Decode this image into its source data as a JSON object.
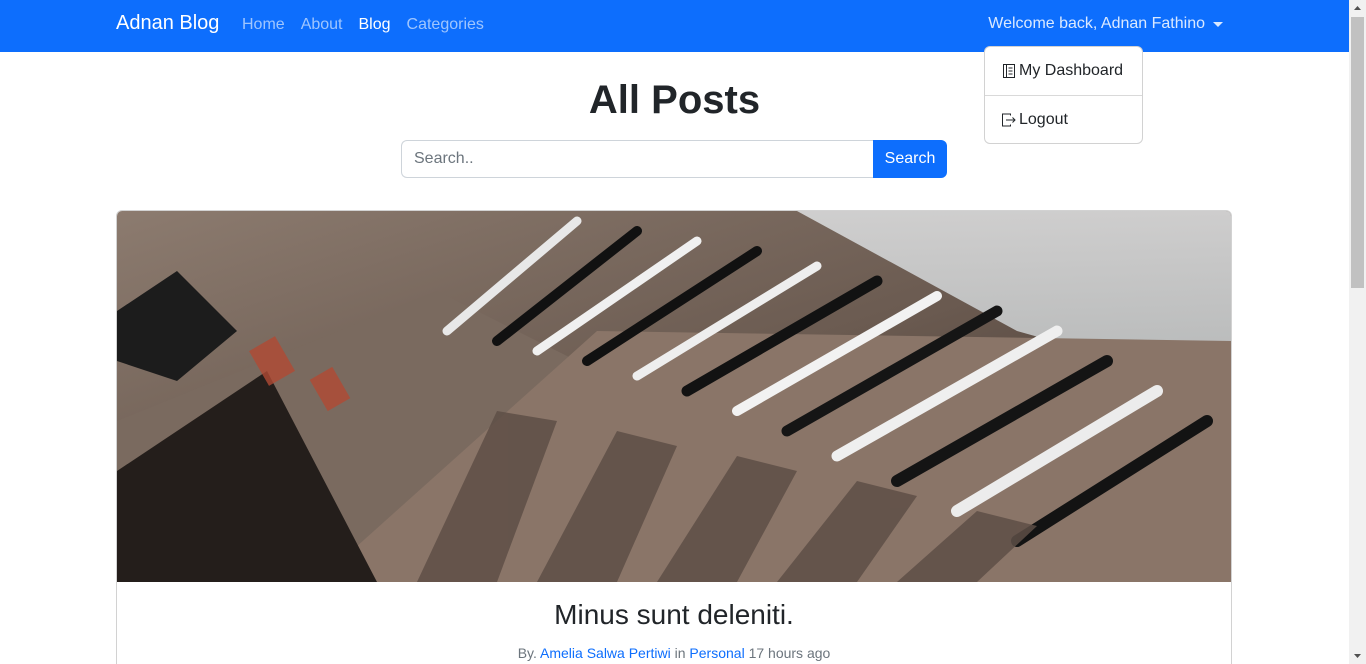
{
  "navbar": {
    "brand": "Adnan Blog",
    "links": [
      {
        "label": "Home",
        "active": false
      },
      {
        "label": "About",
        "active": false
      },
      {
        "label": "Blog",
        "active": true
      },
      {
        "label": "Categories",
        "active": false
      }
    ],
    "user_greeting": "Welcome back, Adnan Fathino",
    "dropdown": {
      "dashboard_label": "My Dashboard",
      "logout_label": "Logout"
    }
  },
  "page": {
    "title": "All Posts"
  },
  "search": {
    "placeholder": "Search..",
    "value": "",
    "button_label": "Search"
  },
  "post": {
    "title": "Minus sunt deleniti.",
    "by_label": "By.",
    "author": "Amelia Salwa Pertiwi",
    "in_label": "in",
    "category": "Personal",
    "time": "17 hours ago"
  },
  "colors": {
    "primary": "#0d6efd",
    "text": "#212529",
    "muted": "#6c757d"
  },
  "icons": {
    "dashboard": "journal-icon",
    "logout": "logout-icon",
    "dropdown": "caret-down-icon"
  }
}
